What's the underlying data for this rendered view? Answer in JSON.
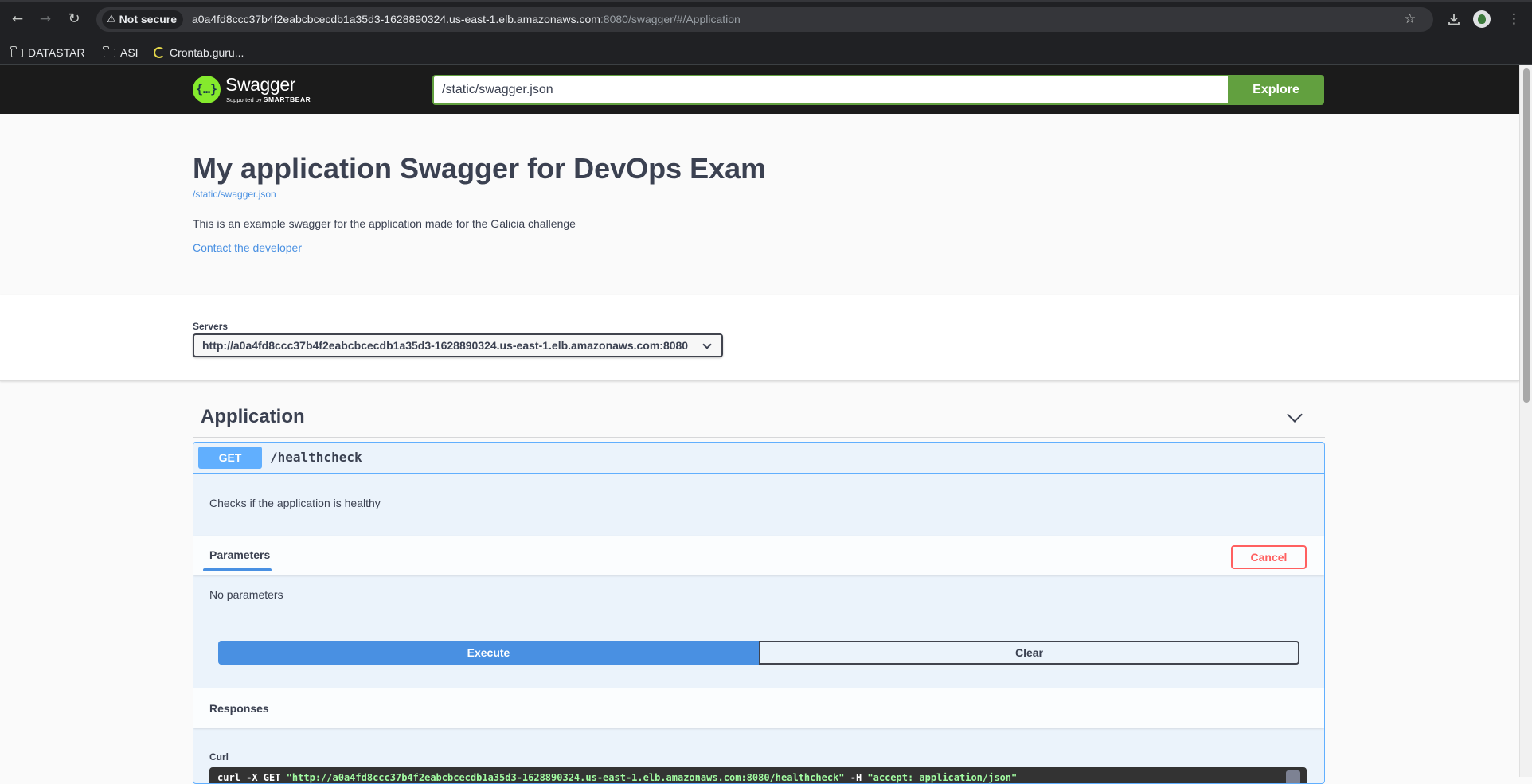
{
  "browser": {
    "security_label": "Not secure",
    "url_host": "a0a4fd8ccc37b4f2eabcbcecdb1a35d3-1628890324.us-east-1.elb.amazonaws.com",
    "url_rest": ":8080/swagger/#/Application",
    "bookmarks": [
      {
        "label": "DATASTAR",
        "icon": "folder-icon"
      },
      {
        "label": "ASI",
        "icon": "folder-icon"
      },
      {
        "label": "Crontab.guru...",
        "icon": "crontab-icon"
      }
    ]
  },
  "topbar": {
    "logo_name": "Swagger",
    "logo_sub_prefix": "Supported by",
    "logo_sub_brand": "SMARTBEAR",
    "logo_glyph": "{…}",
    "spec_url": "/static/swagger.json",
    "explore_label": "Explore",
    "accent_color": "#62a03f"
  },
  "info": {
    "title": "My application Swagger for DevOps Exam",
    "spec_link": "/static/swagger.json",
    "description": "This is an example swagger for the application made for the Galicia challenge",
    "contact_label": "Contact the developer"
  },
  "servers": {
    "label": "Servers",
    "selected": "http://a0a4fd8ccc37b4f2eabcbcecdb1a35d3-1628890324.us-east-1.elb.amazonaws.com:8080"
  },
  "tag": {
    "title": "Application",
    "operation": {
      "method": "GET",
      "method_color": "#61affe",
      "path": "/healthcheck",
      "description": "Checks if the application is healthy",
      "parameters_tab": "Parameters",
      "cancel_label": "Cancel",
      "no_parameters": "No parameters",
      "execute_label": "Execute",
      "clear_label": "Clear",
      "responses_title": "Responses",
      "curl_label": "Curl",
      "curl_cmd": "curl -X GET ",
      "curl_url": "\"http://a0a4fd8ccc37b4f2eabcbcecdb1a35d3-1628890324.us-east-1.elb.amazonaws.com:8080/healthcheck\"",
      "curl_header_flag": " -H ",
      "curl_header": "\"accept: application/json\""
    }
  }
}
